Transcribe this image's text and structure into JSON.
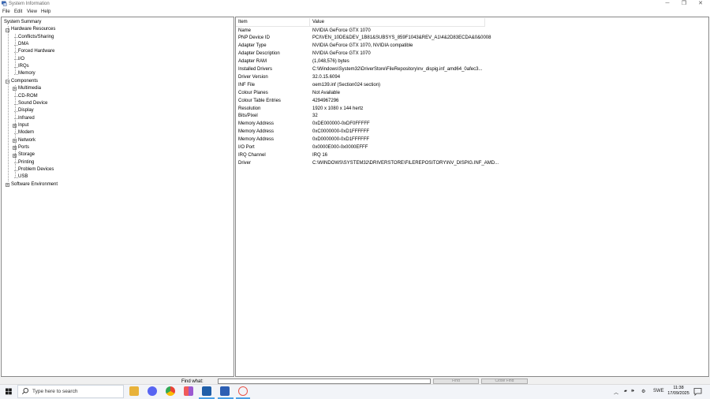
{
  "window": {
    "title": "System Information"
  },
  "menubar": [
    "File",
    "Edit",
    "View",
    "Help"
  ],
  "tree": [
    {
      "label": "System Summary",
      "level": 0,
      "expander": ""
    },
    {
      "label": "Hardware Resources",
      "level": 1,
      "expander": "−"
    },
    {
      "label": "Conflicts/Sharing",
      "level": 2,
      "expander": ""
    },
    {
      "label": "DMA",
      "level": 2,
      "expander": ""
    },
    {
      "label": "Forced Hardware",
      "level": 2,
      "expander": ""
    },
    {
      "label": "I/O",
      "level": 2,
      "expander": ""
    },
    {
      "label": "IRQs",
      "level": 2,
      "expander": ""
    },
    {
      "label": "Memory",
      "level": 2,
      "expander": ""
    },
    {
      "label": "Components",
      "level": 1,
      "expander": "−"
    },
    {
      "label": "Multimedia",
      "level": 2,
      "expander": "+"
    },
    {
      "label": "CD-ROM",
      "level": 2,
      "expander": ""
    },
    {
      "label": "Sound Device",
      "level": 2,
      "expander": ""
    },
    {
      "label": "Display",
      "level": 2,
      "expander": ""
    },
    {
      "label": "Infrared",
      "level": 2,
      "expander": ""
    },
    {
      "label": "Input",
      "level": 2,
      "expander": "+"
    },
    {
      "label": "Modem",
      "level": 2,
      "expander": ""
    },
    {
      "label": "Network",
      "level": 2,
      "expander": "+"
    },
    {
      "label": "Ports",
      "level": 2,
      "expander": "+"
    },
    {
      "label": "Storage",
      "level": 2,
      "expander": "+"
    },
    {
      "label": "Printing",
      "level": 2,
      "expander": ""
    },
    {
      "label": "Problem Devices",
      "level": 2,
      "expander": ""
    },
    {
      "label": "USB",
      "level": 2,
      "expander": ""
    },
    {
      "label": "Software Environment",
      "level": 1,
      "expander": "+"
    }
  ],
  "list": {
    "columns": [
      "Item",
      "Value"
    ],
    "rows": [
      [
        "Name",
        "NVIDIA GeForce GTX 1070"
      ],
      [
        "PNP Device ID",
        "PCI\\VEN_10DE&DEV_1B81&SUBSYS_859F1043&REV_A1\\4&2D83ECDA&0&0008"
      ],
      [
        "Adapter Type",
        "NVIDIA GeForce GTX 1070, NVIDIA compatible"
      ],
      [
        "Adapter Description",
        "NVIDIA GeForce GTX 1070"
      ],
      [
        "Adapter RAM",
        "(1,048,576) bytes"
      ],
      [
        "Installed Drivers",
        "C:\\Windows\\System32\\DriverStore\\FileRepository\\nv_dispig.inf_amd64_0afec3..."
      ],
      [
        "Driver Version",
        "32.0.15.6094"
      ],
      [
        "INF File",
        "oem139.inf (Section024 section)"
      ],
      [
        "Colour Planes",
        "Not Available"
      ],
      [
        "Colour Table Entries",
        "4294967296"
      ],
      [
        "Resolution",
        "1920 x 1080 x 144 hertz"
      ],
      [
        "Bits/Pixel",
        "32"
      ],
      [
        "Memory Address",
        "0xDE000000-0xDF0FFFFF"
      ],
      [
        "Memory Address",
        "0xC0000000-0xD1FFFFFF"
      ],
      [
        "Memory Address",
        "0xD0000000-0xD1FFFFFF"
      ],
      [
        "I/O Port",
        "0x0000E000-0x0000EFFF"
      ],
      [
        "IRQ Channel",
        "IRQ 16"
      ],
      [
        "Driver",
        "C:\\WINDOWS\\SYSTEM32\\DRIVERSTORE\\FILEREPOSITORY\\NV_DISPIG.INF_AMD..."
      ]
    ]
  },
  "findbar": {
    "label": "Find what:",
    "value": "",
    "find_button": "Find",
    "close_button": "Close Find"
  },
  "taskbar": {
    "search_placeholder": "Type here to search",
    "language": "SWE",
    "time": "11:38",
    "date": "17/09/2025"
  },
  "colors": {
    "accent": "#4aa0e6",
    "windows_logo": "#1a1a1a"
  }
}
